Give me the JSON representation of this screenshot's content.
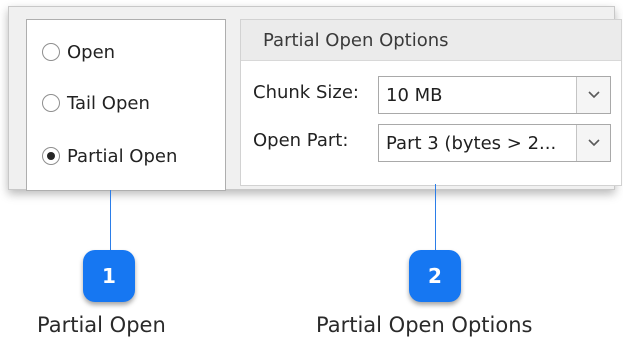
{
  "mode_group": {
    "options": [
      {
        "label": "Open",
        "checked": false
      },
      {
        "label": "Tail Open",
        "checked": false
      },
      {
        "label": "Partial Open",
        "checked": true
      }
    ]
  },
  "partial_options": {
    "title": "Partial Open Options",
    "chunk_size": {
      "label": "Chunk Size:",
      "value": "10 MB"
    },
    "open_part": {
      "label": "Open Part:",
      "value": "Part 3 (bytes > 2..."
    }
  },
  "callouts": [
    {
      "number": "1",
      "label": "Partial Open"
    },
    {
      "number": "2",
      "label": "Partial Open Options"
    }
  ],
  "colors": {
    "accent": "#1677f2",
    "connector": "#2b7de8"
  }
}
